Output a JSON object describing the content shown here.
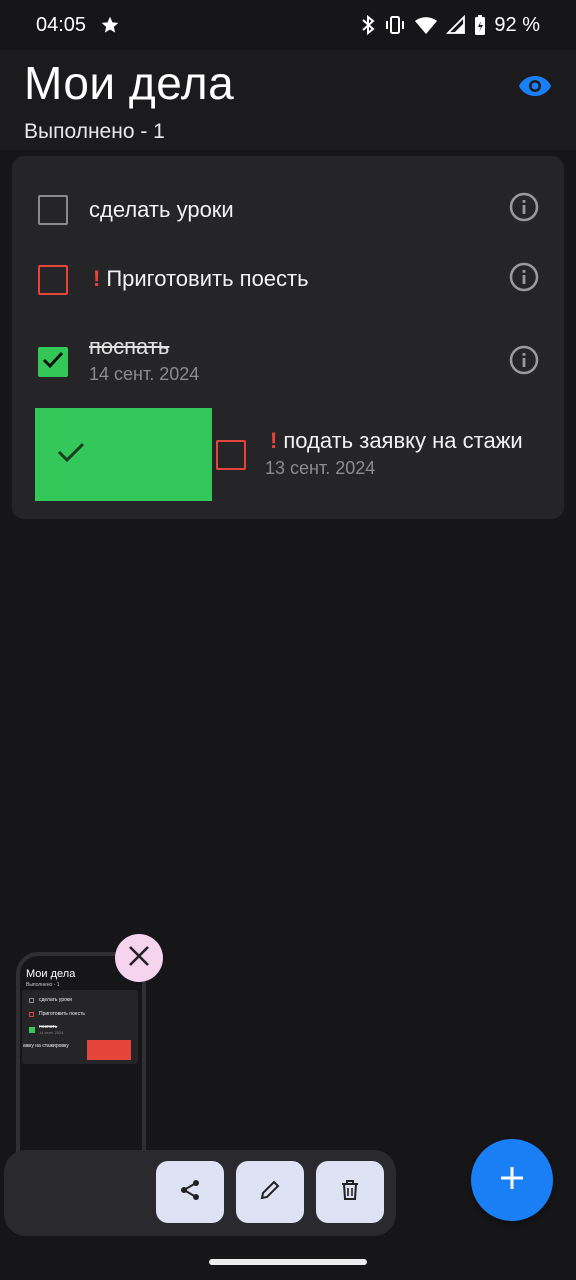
{
  "status_bar": {
    "time": "04:05",
    "battery": "92 %"
  },
  "header": {
    "title": "Мои дела",
    "subtitle": "Выполнено - 1"
  },
  "tasks": [
    {
      "text": "сделать уроки",
      "important": false,
      "done": false,
      "date": ""
    },
    {
      "text": "Приготовить поесть",
      "important": true,
      "done": false,
      "date": ""
    },
    {
      "text": "поспать",
      "important": false,
      "done": true,
      "date": "14 сент. 2024"
    },
    {
      "text": "подать заявку на стажи",
      "important": true,
      "done": false,
      "date": "13 сент. 2024",
      "swiping": true
    }
  ],
  "thumbnail": {
    "title": "Мои дела",
    "subtitle": "Выполнено - 1",
    "rows": [
      "сделать уроки",
      "Приготовить поесть",
      "поспать",
      "ажку на стажировку"
    ],
    "date": "14 сент. 2024"
  },
  "icons": {
    "eye": "eye-icon",
    "info": "info-icon",
    "share": "share-icon",
    "edit": "pencil-icon",
    "delete": "trash-icon",
    "add": "plus-icon",
    "close": "close-icon"
  },
  "colors": {
    "accent_blue": "#1a7ef5",
    "done_green": "#34c759",
    "important_red": "#e5443a"
  }
}
